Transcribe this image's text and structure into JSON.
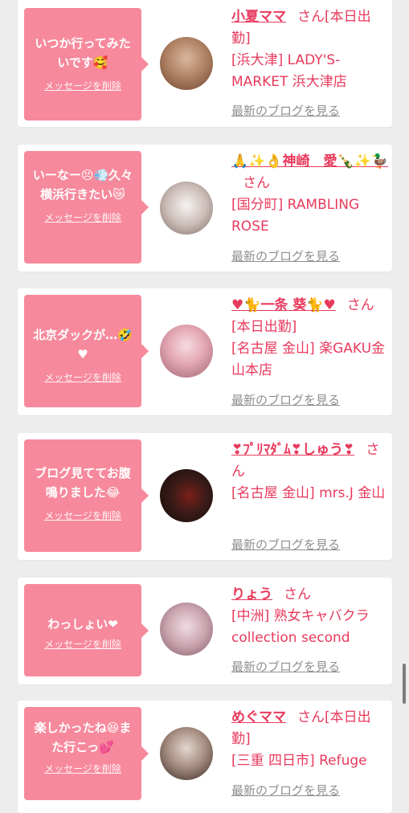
{
  "cards": [
    {
      "message": "いつか行ってみたいです🥰",
      "delete_label": "メッセージを削除",
      "name": "小夏ママ",
      "san": "さん",
      "status": "[本日出勤]",
      "shop": "[浜大津] LADY'S-MARKET 浜大津店",
      "blog_label": "最新のブログを見る",
      "avatar_colors": [
        "#d9b7a0",
        "#8a5a3c"
      ]
    },
    {
      "message": "いーなー😣💨久々横浜行きたい😿",
      "delete_label": "メッセージを削除",
      "name": "🙏✨👌神崎　愛🍾✨🦆",
      "san": "さん",
      "status": "",
      "shop": "[国分町] RAMBLING ROSE",
      "blog_label": "最新のブログを見る",
      "avatar_colors": [
        "#f1eeee",
        "#9b8a86"
      ]
    },
    {
      "message": "北京ダックが…🤣♥",
      "delete_label": "メッセージを削除",
      "name": "♥🐈一条 葵🐈♥",
      "san": "さん",
      "status": "[本日出勤]",
      "shop": "[名古屋 金山] 楽GAKU金山本店",
      "blog_label": "最新のブログを見る",
      "avatar_colors": [
        "#f3c3cf",
        "#c98b96"
      ]
    },
    {
      "message": "ブログ見ててお腹鳴りました😂",
      "delete_label": "メッセージを削除",
      "name": "❣ﾌﾟﾘﾏﾀﾞﾑ❣しゅう❣",
      "san": "さん",
      "status": "",
      "shop": "[名古屋 金山] mrs.J 金山",
      "blog_label": "最新のブログを見る",
      "avatar_colors": [
        "#2a1714",
        "#b2251f"
      ]
    },
    {
      "message": "わっしょい❤",
      "delete_label": "メッセージを削除",
      "name": "りょう",
      "san": "さん",
      "status": "",
      "shop": "[中洲] 熟女キャバクラ collection second",
      "blog_label": "最新のブログを見る",
      "avatar_colors": [
        "#e6cfd6",
        "#a57f8a"
      ]
    },
    {
      "message": "楽しかったね😆また行こっ💕",
      "delete_label": "メッセージを削除",
      "name": "めぐママ",
      "san": "さん",
      "status": "[本日出勤]",
      "shop": "[三重 四日市] Refuge",
      "blog_label": "最新のブログを見る",
      "avatar_colors": [
        "#d3c6bd",
        "#3a2a26"
      ]
    }
  ]
}
